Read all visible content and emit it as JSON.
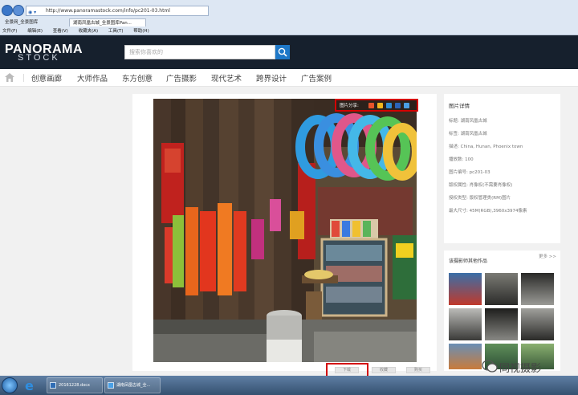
{
  "browser": {
    "url": "http://www.panoramastock.com/info/pc201-03.html",
    "tabs": [
      "全景网_全景图库",
      "湖南凤凰古城_全景图库Pan..."
    ],
    "menu": [
      "文件(F)",
      "编辑(E)",
      "查看(V)",
      "收藏夹(A)",
      "工具(T)",
      "帮助(H)"
    ]
  },
  "site": {
    "logo_top": "PANORAMA",
    "logo_bottom": "STOCK",
    "search_placeholder": "搜索你喜欢的"
  },
  "nav": {
    "items": [
      "创意画廊",
      "大师作品",
      "东方创意",
      "广告摄影",
      "现代艺术",
      "跨界设计",
      "广告案例"
    ]
  },
  "photo": {
    "share_label": "图片分享:",
    "share_icons": [
      "weibo-icon",
      "qzone-icon",
      "tencent-icon",
      "renren-icon",
      "more-share-icon"
    ]
  },
  "actions": [
    "下载",
    "收藏",
    "购买"
  ],
  "info": {
    "title": "图片详情",
    "lines": [
      "标题: 湖南凤凰古城",
      "标签: 湖南凤凰古城",
      "描述: China, Hunan, Phoenix town",
      "播放数: 100",
      "图片编号: pc201-03",
      "版权属性: 肖像权(不需要肖像权)",
      "授权类型: 版权管理类(RM)图片",
      "最大尺寸: 45M(RGB),3960x3974像素"
    ]
  },
  "similar": {
    "title": "该摄影师其他作品",
    "more": "更多 >>"
  },
  "taskbar": {
    "items": [
      "20161228.docx",
      "湖南凤凰古城_全..."
    ]
  },
  "watermark": "同视摄影",
  "colors": {
    "header_bg": "#16202d",
    "accent": "#1e78c8",
    "highlight": "#d40000"
  }
}
